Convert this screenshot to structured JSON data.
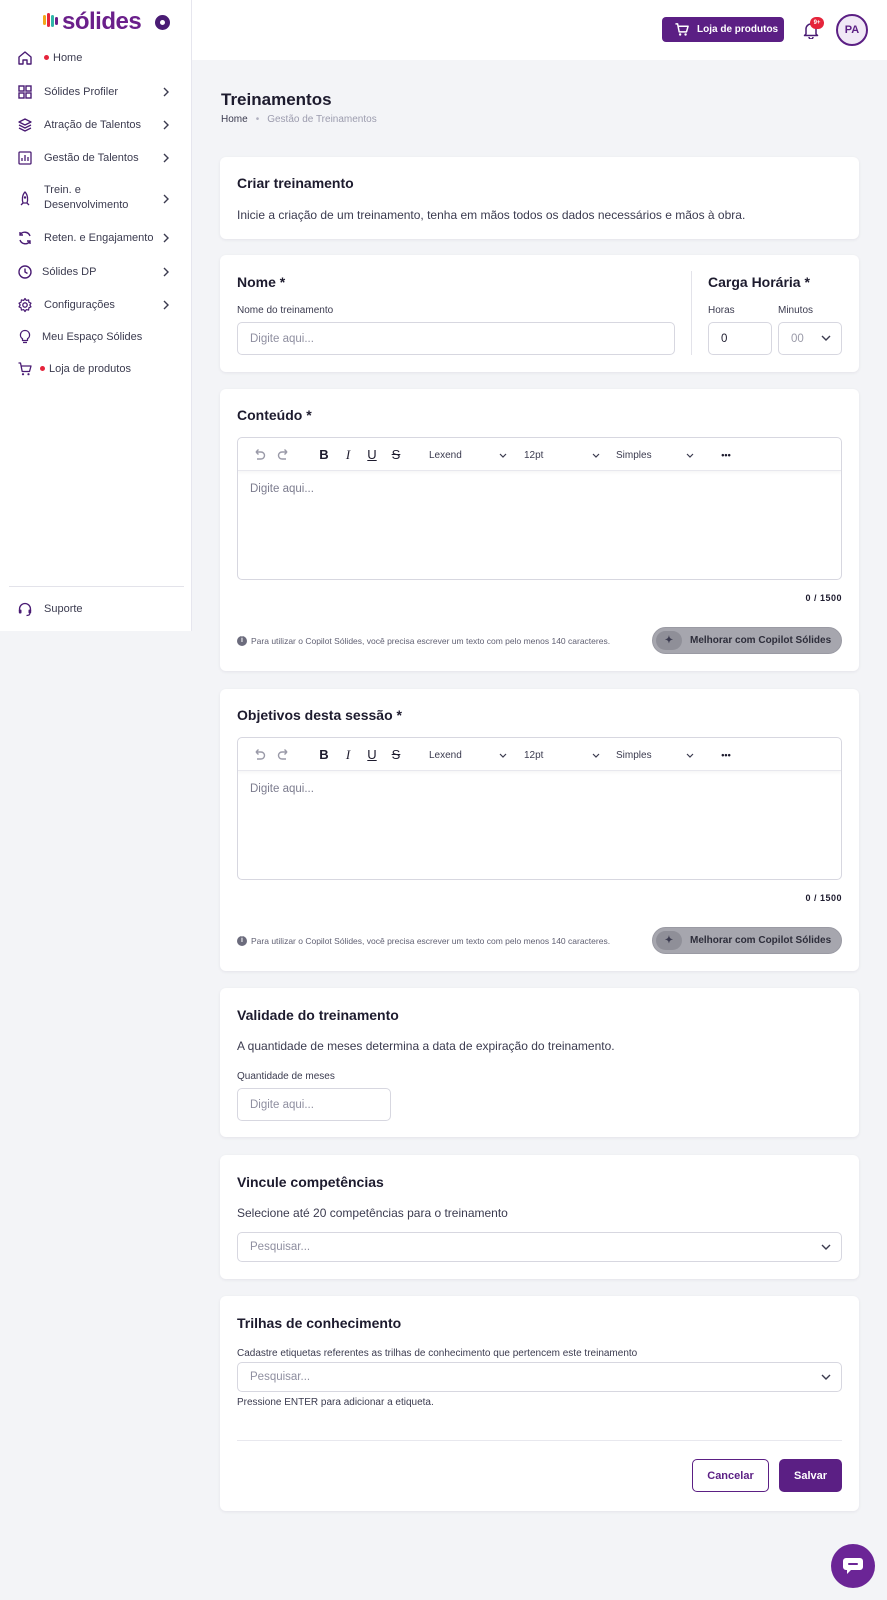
{
  "brand": {
    "logo_text": "sólides"
  },
  "sidebar": {
    "items": [
      {
        "label": "Home",
        "icon": "home-icon",
        "dot": true
      },
      {
        "label": "Sólides Profiler",
        "icon": "grid-icon"
      },
      {
        "label": "Atração de Talentos",
        "icon": "layers-icon"
      },
      {
        "label": "Gestão de Talentos",
        "icon": "bar-chart-icon"
      },
      {
        "label": "Trein. e Desenvolvimento",
        "label_line1": "Trein. e",
        "label_line2": "Desenvolvimento",
        "icon": "rocket-icon"
      },
      {
        "label": "Reten. e Engajamento",
        "icon": "refresh-icon"
      },
      {
        "label": "Sólides DP",
        "icon": "clock-icon"
      },
      {
        "label": "Configurações",
        "icon": "gear-icon"
      },
      {
        "label": "Meu Espaço Sólides",
        "icon": "lightbulb-icon"
      },
      {
        "label": "Loja de produtos",
        "icon": "cart-icon",
        "dot": true
      }
    ],
    "support": {
      "label": "Suporte",
      "icon": "headset-icon"
    }
  },
  "header": {
    "store_button": "Loja de produtos",
    "notification_badge": "9+",
    "avatar_initials": "PA"
  },
  "page": {
    "title": "Treinamentos",
    "breadcrumb": [
      "Home",
      "Gestão de Treinamentos"
    ]
  },
  "create_card": {
    "title": "Criar treinamento",
    "description": "Inicie a criação de um treinamento, tenha em mãos todos os dados necessários e mãos à obra."
  },
  "name_card": {
    "title": "Nome *",
    "field_label": "Nome do treinamento",
    "placeholder": "Digite aqui...",
    "workload_title": "Carga Horária *",
    "hours_label": "Horas",
    "hours_value": "0",
    "minutes_label": "Minutos",
    "minutes_value": "00"
  },
  "editor_toolbar": {
    "font": "Lexend",
    "size": "12pt",
    "line_spacing": "Simples",
    "bold": "B",
    "italic": "I",
    "underline": "U",
    "strike": "S",
    "more": "•••"
  },
  "content_card": {
    "title": "Conteúdo *",
    "placeholder": "Digite aqui...",
    "counter": "0 / 1500",
    "info": "Para utilizar o Copilot Sólides, você precisa escrever um texto com pelo menos 140 caracteres.",
    "copilot_button": "Melhorar com Copilot Sólides"
  },
  "objectives_card": {
    "title": "Objetivos desta sessão *",
    "placeholder": "Digite aqui...",
    "counter": "0 / 1500",
    "info": "Para utilizar o Copilot Sólides, você precisa escrever um texto com pelo menos 140 caracteres.",
    "copilot_button": "Melhorar com Copilot Sólides"
  },
  "validity_card": {
    "title": "Validade do treinamento",
    "description": "A quantidade de meses determina a data de expiração do treinamento.",
    "field_label": "Quantidade de meses",
    "placeholder": "Digite aqui..."
  },
  "skills_card": {
    "title": "Vincule competências",
    "description": "Selecione até 20 competências para o treinamento",
    "placeholder": "Pesquisar..."
  },
  "tracks_card": {
    "title": "Trilhas de conhecimento",
    "description": "Cadastre etiquetas referentes as trilhas de conhecimento que pertencem este treinamento",
    "placeholder": "Pesquisar...",
    "hint": "Pressione ENTER para adicionar a etiqueta.",
    "cancel": "Cancelar",
    "save": "Salvar"
  },
  "colors": {
    "primary": "#5b1f84",
    "alert": "#e5243b",
    "background": "#f3f4f7"
  }
}
